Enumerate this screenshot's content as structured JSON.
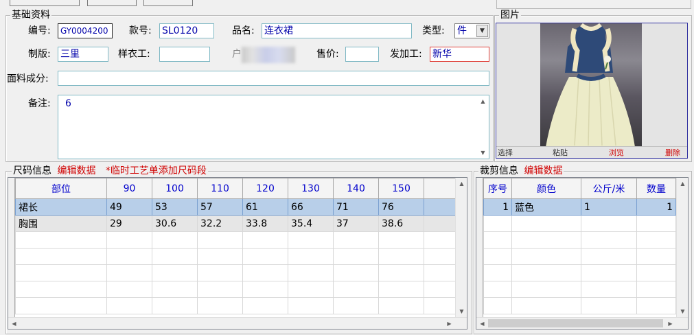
{
  "basic": {
    "legend": "基础资料",
    "code_label": "编号:",
    "code_value": "GY0004200",
    "style_label": "款号:",
    "style_value": "SL0120",
    "name_label": "品名:",
    "name_value": "连衣裙",
    "type_label": "类型:",
    "type_value": "件",
    "plate_label": "制版:",
    "plate_value": "三里",
    "sample_label": "样衣工:",
    "sample_value": "",
    "blurred_label": "户",
    "price_label": "售价:",
    "price_value": "",
    "process_label": "发加工:",
    "process_value": "新华",
    "fabric_label": "面料成分:",
    "fabric_value": "",
    "remark_label": "备注:",
    "remark_value": "6"
  },
  "picture": {
    "legend": "图片",
    "buttons": [
      "选择",
      "粘贴",
      "浏览",
      "删除"
    ],
    "image_icon": "dress-photo"
  },
  "size": {
    "legend": "尺码信息",
    "edit_link": "编辑数据",
    "add_link": "*临时工艺单添加尺码段",
    "columns": [
      "部位",
      "90",
      "100",
      "110",
      "120",
      "130",
      "140",
      "150"
    ],
    "rows": [
      [
        "裙长",
        "49",
        "53",
        "57",
        "61",
        "66",
        "71",
        "76"
      ],
      [
        "胸围",
        "29",
        "30.6",
        "32.2",
        "33.8",
        "35.4",
        "37",
        "38.6"
      ]
    ]
  },
  "cut": {
    "legend": "裁剪信息",
    "edit_link": "编辑数据",
    "columns": [
      "序号",
      "颜色",
      "公斤/米",
      "数量"
    ],
    "rows": [
      [
        "1",
        "蓝色",
        "1",
        "1"
      ]
    ]
  }
}
